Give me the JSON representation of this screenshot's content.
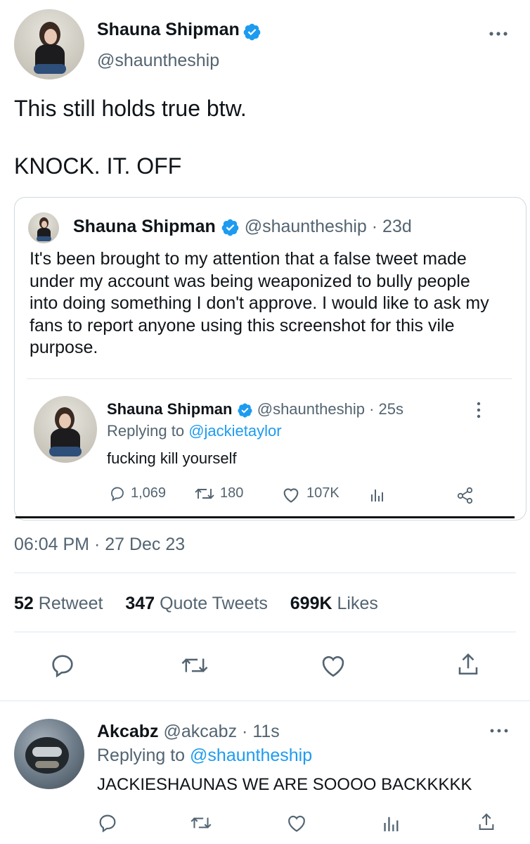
{
  "main_tweet": {
    "author_name": "Shauna Shipman",
    "handle": "@shauntheship",
    "text_line1": "This still holds true btw.",
    "text_line2": "KNOCK. IT. OFF",
    "timestamp": "06:04 PM · 27 Dec 23",
    "stats": {
      "retweets_count": "52",
      "retweets_label": "Retweet",
      "quotes_count": "347",
      "quotes_label": "Quote Tweets",
      "likes_count": "699K",
      "likes_label": "Likes"
    }
  },
  "quoted_tweet": {
    "author_name": "Shauna Shipman",
    "handle": "@shauntheship",
    "age": "· 23d",
    "text": "It's been brought to my attention that a false tweet made under my account was being weaponized to bully people into doing something I don't approve. I would like to ask my fans to report anyone using this screenshot for this vile purpose."
  },
  "screenshot_tweet": {
    "author_name": "Shauna Shipman",
    "handle": "@shauntheship",
    "age": "· 25s",
    "replying_prefix": "Replying to",
    "replying_to": "@jackietaylor",
    "text": "fucking kill yourself",
    "replies": "1,069",
    "retweets": "180",
    "likes": "107K"
  },
  "reply_tweet": {
    "author_name": "Akcabz",
    "handle": "@akcabz",
    "age": "· 11s",
    "replying_prefix": "Replying to",
    "replying_to": "@shauntheship",
    "text": "JACKIESHAUNAS WE ARE SOOOO BACKKKKK"
  },
  "colors": {
    "accent": "#1d9bf0",
    "text": "#0f1419",
    "secondary": "#536471",
    "divider": "#e1e8ed"
  },
  "icons": [
    "verified-badge-icon",
    "more-icon",
    "reply-icon",
    "retweet-icon",
    "like-icon",
    "share-icon",
    "analytics-icon"
  ]
}
